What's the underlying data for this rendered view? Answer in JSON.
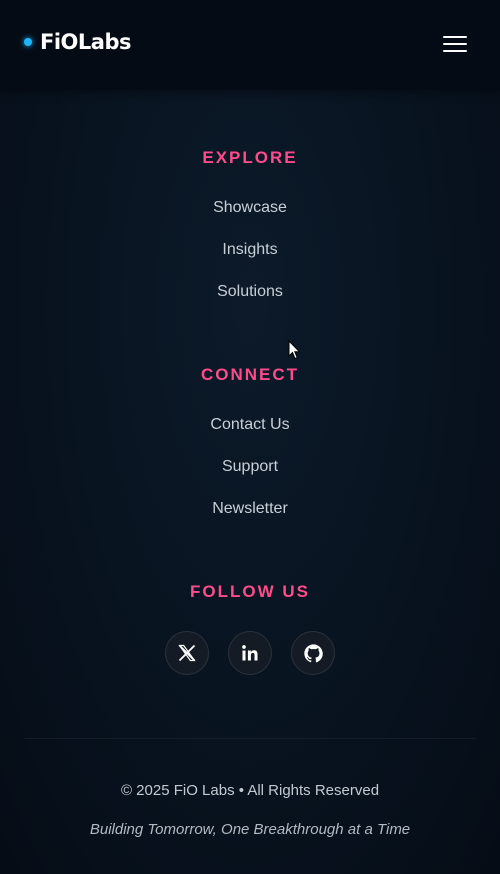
{
  "header": {
    "logo_text": "FiOLabs",
    "menu_icon": "hamburger-menu-icon"
  },
  "explore": {
    "title": "EXPLORE",
    "links": [
      "Showcase",
      "Insights",
      "Solutions"
    ]
  },
  "connect": {
    "title": "CONNECT",
    "links": [
      "Contact Us",
      "Support",
      "Newsletter"
    ]
  },
  "follow": {
    "title": "FOLLOW US",
    "socials": [
      "x-icon",
      "linkedin-icon",
      "github-icon"
    ]
  },
  "footer": {
    "copyright": "© 2025 FiO Labs • All Rights Reserved",
    "tagline": "Building Tomorrow, One Breakthrough at a Time"
  },
  "colors": {
    "accent_pink": "#ff4b8b",
    "logo_dot": "#1fb6ff",
    "background": "#07111d"
  }
}
